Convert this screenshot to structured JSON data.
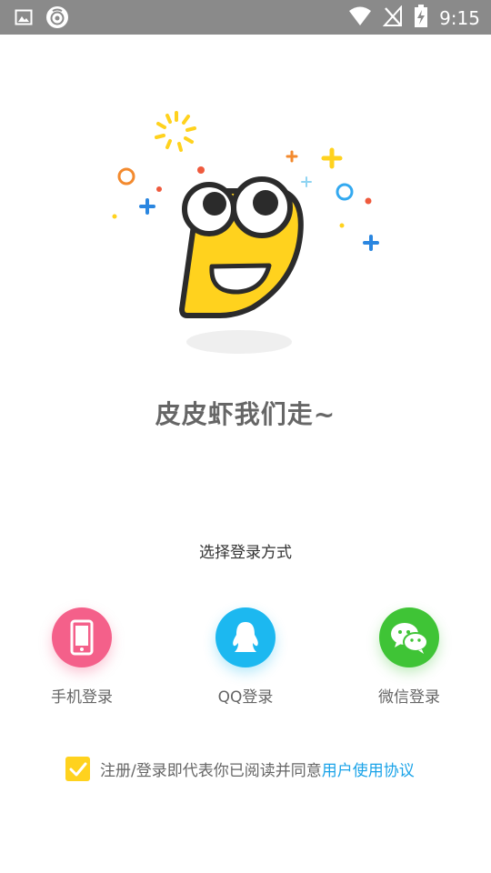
{
  "status_bar": {
    "time": "9:15",
    "left_icons": [
      "image-icon",
      "app-camera-icon"
    ],
    "right_icons": [
      "wifi-icon",
      "no-signal-icon",
      "battery-charging-icon"
    ]
  },
  "hero": {
    "mascot": "pipixia-mascot",
    "slogan": "皮皮虾我们走~"
  },
  "login": {
    "title": "选择登录方式",
    "options": [
      {
        "label": "手机登录",
        "icon": "phone-icon",
        "color": "#f4608a"
      },
      {
        "label": "QQ登录",
        "icon": "qq-penguin-icon",
        "color": "#1cb8f0"
      },
      {
        "label": "微信登录",
        "icon": "wechat-icon",
        "color": "#3fc436"
      }
    ]
  },
  "agreement": {
    "checked": true,
    "text": "注册/登录即代表你已阅读并同意",
    "link": "用户使用协议"
  }
}
